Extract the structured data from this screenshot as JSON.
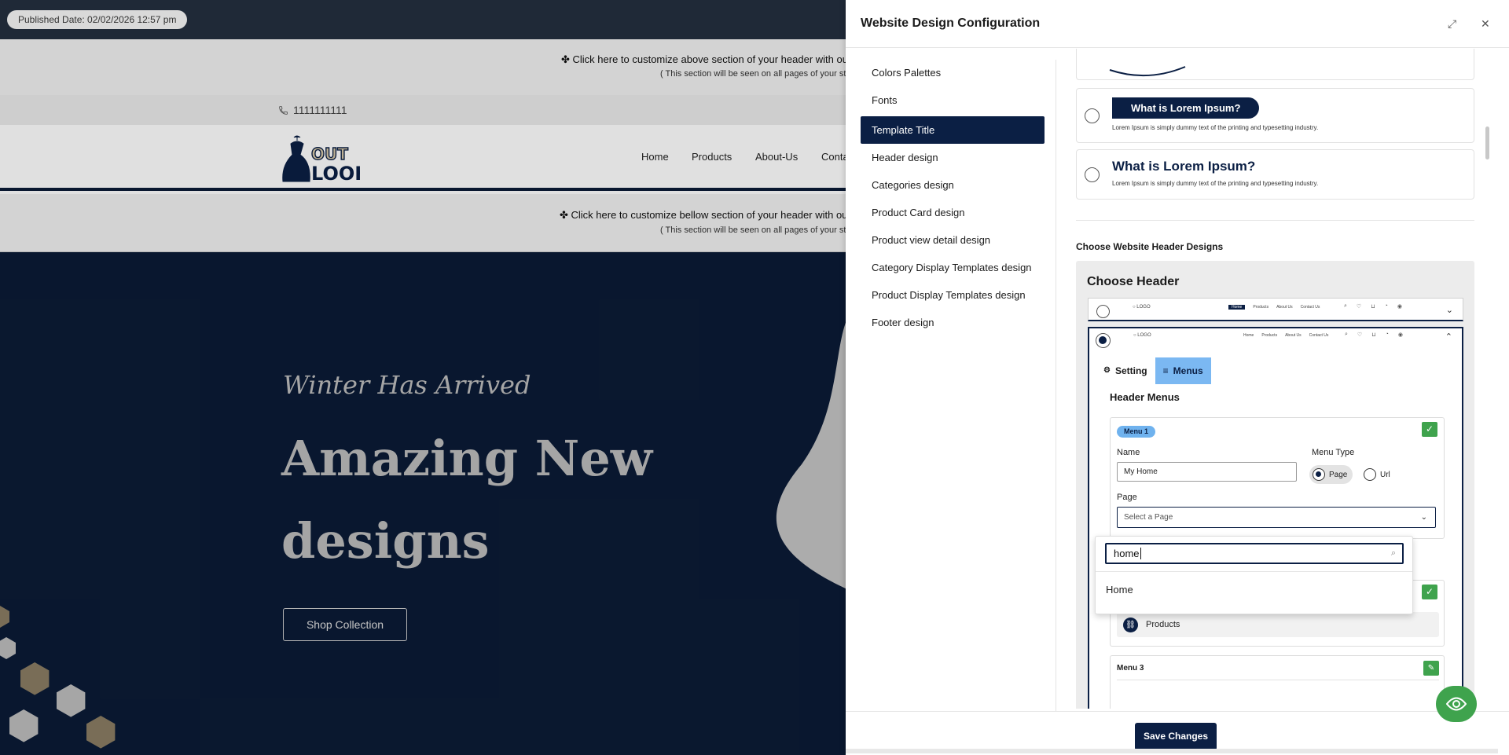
{
  "preview": {
    "published_date": "Published Date: 02/02/2026 12:57 pm",
    "top_customize": "✤ Click here to customize above section of your header with our po",
    "top_customize_note": "( This section will be seen on all pages of your store",
    "phone": "1111111111",
    "logo": {
      "line1": "OUT",
      "line2": "LOOK"
    },
    "nav": [
      "Home",
      "Products",
      "About-Us",
      "Conta"
    ],
    "bottom_customize": "✤ Click here to customize bellow section of your header with our po",
    "bottom_customize_note": "( This section will be seen on all pages of your store",
    "hero_subtitle": "Winter Has Arrived",
    "hero_title": "Amazing New designs",
    "hero_button": "Shop Collection"
  },
  "panel": {
    "title": "Website Design Configuration",
    "menu": [
      "Colors Palettes",
      "Fonts",
      "Template Title",
      "Header design",
      "Categories design",
      "Product Card design",
      "Product view detail design",
      "Category Display Templates design",
      "Product Display Templates design",
      "Footer design"
    ],
    "active_menu": "Template Title",
    "template_options": {
      "pill_title": "What is Lorem Ipsum?",
      "plain_title": "What is Lorem Ipsum?",
      "lorem": "Lorem Ipsum is simply dummy text of the printing and typesetting industry."
    },
    "section_label": "Choose Website Header Designs",
    "choose_header": "Choose Header",
    "mini_header": {
      "logo": "LOGO",
      "nav": [
        "Home",
        "Products",
        "About Us",
        "Contact Us"
      ],
      "icons": [
        "Search",
        "Wish",
        "Bag",
        "Notification",
        "Profile"
      ]
    },
    "tabs": {
      "setting": "Setting",
      "menus": "Menus"
    },
    "header_menus_title": "Header Menus",
    "menu1": {
      "badge": "Menu 1",
      "name_label": "Name",
      "name_value": "My Home",
      "type_label": "Menu Type",
      "type_page": "Page",
      "type_url": "Url",
      "page_label": "Page",
      "page_placeholder": "Select a Page"
    },
    "dropdown": {
      "search_value": "home",
      "options": [
        "Home"
      ]
    },
    "menu2_item": "Products",
    "menu3_label": "Menu 3",
    "save_label": "Save Changes"
  },
  "colors": {
    "navy": "#0b1f44",
    "accent_green": "#3fa34d",
    "tab_blue": "#7bb8f2"
  }
}
